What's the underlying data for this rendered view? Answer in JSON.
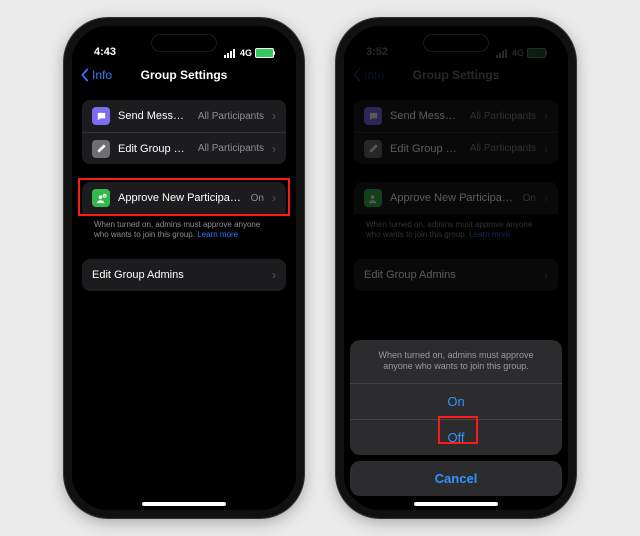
{
  "phone1": {
    "status": {
      "time": "4:43",
      "net": "4G",
      "battery": "100"
    },
    "nav": {
      "back": "Info",
      "title": "Group Settings"
    },
    "group1": {
      "row1": {
        "label": "Send Messages",
        "value": "All Participants",
        "icon_bg": "#7c6df2"
      },
      "row2": {
        "label": "Edit Group Settings",
        "value": "All Participants",
        "icon_bg": "#6e6e73"
      }
    },
    "group2": {
      "row1": {
        "label": "Approve New Participants",
        "value": "On",
        "icon_bg": "#33b84b"
      }
    },
    "desc": {
      "text": "When turned on, admins must approve anyone who wants to join this group.",
      "link": "Learn more"
    },
    "group3": {
      "row1": {
        "label": "Edit Group Admins"
      }
    }
  },
  "phone2": {
    "status": {
      "time": "3:52",
      "net": "4G",
      "battery": "100"
    },
    "nav": {
      "back": "Info",
      "title": "Group Settings"
    },
    "group1": {
      "row1": {
        "label": "Send Messages",
        "value": "All Participants",
        "icon_bg": "#7c6df2"
      },
      "row2": {
        "label": "Edit Group Settings",
        "value": "All Participants",
        "icon_bg": "#6e6e73"
      }
    },
    "group2": {
      "row1": {
        "label": "Approve New Participants",
        "value": "On",
        "icon_bg": "#33b84b"
      }
    },
    "desc": {
      "text": "When turned on, admins must approve anyone who wants to join this group.",
      "link": "Learn more"
    },
    "group3": {
      "row1": {
        "label": "Edit Group Admins"
      }
    },
    "sheet": {
      "header": "When turned on, admins must approve anyone who wants to join this group.",
      "opt_on": "On",
      "opt_off": "Off",
      "cancel": "Cancel"
    }
  }
}
